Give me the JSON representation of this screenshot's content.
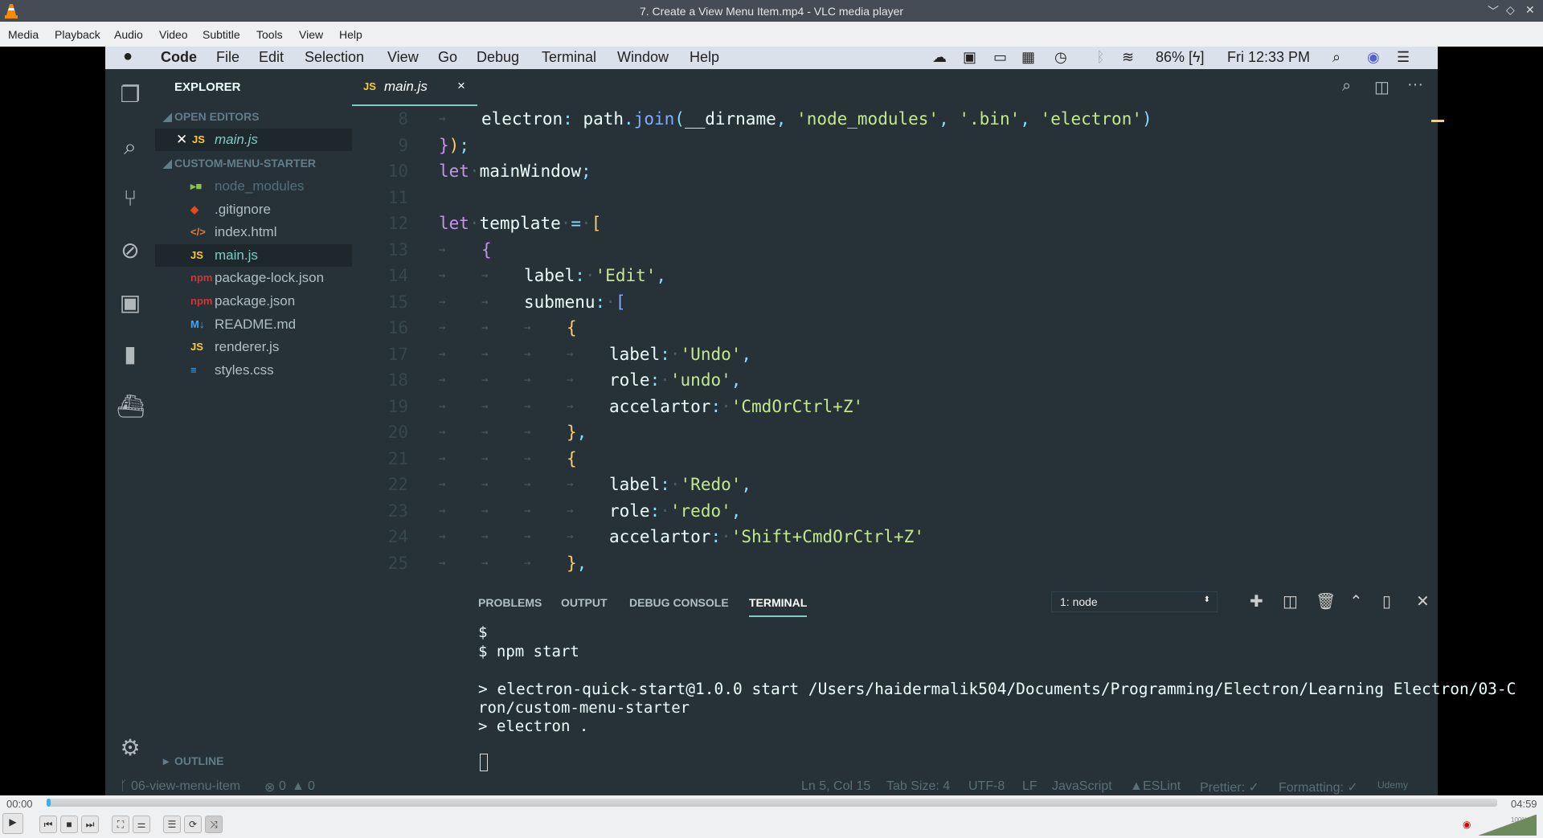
{
  "window": {
    "title": "7. Create a View Menu Item.mp4 - VLC media player"
  },
  "vlc_menu": [
    "Media",
    "Playback",
    "Audio",
    "Video",
    "Subtitle",
    "Tools",
    "View",
    "Help"
  ],
  "mac_menu": {
    "app": "Code",
    "items": [
      "File",
      "Edit",
      "Selection",
      "View",
      "Go",
      "Debug",
      "Terminal",
      "Window",
      "Help"
    ],
    "battery": "86%",
    "clock": "Fri 12:33 PM"
  },
  "sidebar": {
    "title": "EXPLORER",
    "open_editors": "OPEN EDITORS",
    "open_file": "main.js",
    "project": "CUSTOM-MENU-STARTER",
    "files": [
      {
        "name": "node_modules",
        "icon": "folder-icon",
        "badge": "▸■",
        "color": "#8bc34a"
      },
      {
        "name": ".gitignore",
        "icon": "git-icon",
        "badge": "◆",
        "color": "#e64a19"
      },
      {
        "name": "index.html",
        "icon": "html-icon",
        "badge": "</>",
        "color": "#e37933"
      },
      {
        "name": "main.js",
        "icon": "js-icon",
        "badge": "JS",
        "color": "#ffca28",
        "selected": true
      },
      {
        "name": "package-lock.json",
        "icon": "npm-icon",
        "badge": "npm",
        "color": "#cb3837"
      },
      {
        "name": "package.json",
        "icon": "npm-icon",
        "badge": "npm",
        "color": "#cb3837"
      },
      {
        "name": "README.md",
        "icon": "markdown-icon",
        "badge": "M↓",
        "color": "#42a5f5"
      },
      {
        "name": "renderer.js",
        "icon": "js-icon",
        "badge": "JS",
        "color": "#ffca28"
      },
      {
        "name": "styles.css",
        "icon": "css-icon",
        "badge": "≡",
        "color": "#42a5f5"
      }
    ],
    "outline": "OUTLINE"
  },
  "editor": {
    "tab": {
      "label": "main.js",
      "badge": "JS",
      "close": "×"
    },
    "lines": [
      {
        "n": "8",
        "indent": 1,
        "tokens": [
          [
            "electron",
            "id"
          ],
          [
            ":",
            "p"
          ],
          [
            " ",
            "ws"
          ],
          [
            "path",
            "id"
          ],
          [
            ".",
            "p"
          ],
          [
            "join",
            "fn"
          ],
          [
            "(",
            "p"
          ],
          [
            "__dirname",
            "id"
          ],
          [
            ",",
            "p"
          ],
          [
            " ",
            "ws"
          ],
          [
            "'node_modules'",
            "str"
          ],
          [
            ",",
            "p"
          ],
          [
            " ",
            "ws"
          ],
          [
            "'.bin'",
            "str"
          ],
          [
            ",",
            "p"
          ],
          [
            " ",
            "ws"
          ],
          [
            "'electron'",
            "str"
          ],
          [
            ")",
            "p"
          ]
        ]
      },
      {
        "n": "9",
        "indent": 0,
        "tokens": [
          [
            "}",
            "br1"
          ],
          [
            ")",
            "br2"
          ],
          [
            ";",
            "p"
          ]
        ]
      },
      {
        "n": "10",
        "indent": 0,
        "tokens": [
          [
            "let",
            "kw"
          ],
          [
            "·",
            "ws"
          ],
          [
            "mainWindow",
            "id"
          ],
          [
            ";",
            "p"
          ]
        ]
      },
      {
        "n": "11",
        "indent": 0,
        "tokens": []
      },
      {
        "n": "12",
        "indent": 0,
        "tokens": [
          [
            "let",
            "kw"
          ],
          [
            "·",
            "ws"
          ],
          [
            "template",
            "id"
          ],
          [
            "·",
            "ws"
          ],
          [
            "=",
            "p"
          ],
          [
            "·",
            "ws"
          ],
          [
            "[",
            "br2"
          ]
        ]
      },
      {
        "n": "13",
        "indent": 1,
        "tokens": [
          [
            "{",
            "br1"
          ]
        ]
      },
      {
        "n": "14",
        "indent": 2,
        "tokens": [
          [
            "label",
            "id"
          ],
          [
            ":",
            "p"
          ],
          [
            "·",
            "ws"
          ],
          [
            "'Edit'",
            "str"
          ],
          [
            ",",
            "p"
          ]
        ]
      },
      {
        "n": "15",
        "indent": 2,
        "tokens": [
          [
            "submenu",
            "id"
          ],
          [
            ":",
            "p"
          ],
          [
            "·",
            "ws"
          ],
          [
            "[",
            "fn"
          ]
        ]
      },
      {
        "n": "16",
        "indent": 3,
        "tokens": [
          [
            "{",
            "br2"
          ]
        ]
      },
      {
        "n": "17",
        "indent": 4,
        "tokens": [
          [
            "label",
            "id"
          ],
          [
            ":",
            "p"
          ],
          [
            "·",
            "ws"
          ],
          [
            "'Undo'",
            "str"
          ],
          [
            ",",
            "p"
          ]
        ]
      },
      {
        "n": "18",
        "indent": 4,
        "tokens": [
          [
            "role",
            "id"
          ],
          [
            ":",
            "p"
          ],
          [
            "·",
            "ws"
          ],
          [
            "'undo'",
            "str"
          ],
          [
            ",",
            "p"
          ]
        ]
      },
      {
        "n": "19",
        "indent": 4,
        "tokens": [
          [
            "accelartor",
            "id"
          ],
          [
            ":",
            "p"
          ],
          [
            "·",
            "ws"
          ],
          [
            "'CmdOrCtrl+Z'",
            "str"
          ]
        ]
      },
      {
        "n": "20",
        "indent": 3,
        "tokens": [
          [
            "}",
            "br2"
          ],
          [
            ",",
            "p"
          ]
        ]
      },
      {
        "n": "21",
        "indent": 3,
        "tokens": [
          [
            "{",
            "br2"
          ]
        ]
      },
      {
        "n": "22",
        "indent": 4,
        "tokens": [
          [
            "label",
            "id"
          ],
          [
            ":",
            "p"
          ],
          [
            "·",
            "ws"
          ],
          [
            "'Redo'",
            "str"
          ],
          [
            ",",
            "p"
          ]
        ]
      },
      {
        "n": "23",
        "indent": 4,
        "tokens": [
          [
            "role",
            "id"
          ],
          [
            ":",
            "p"
          ],
          [
            "·",
            "ws"
          ],
          [
            "'redo'",
            "str"
          ],
          [
            ",",
            "p"
          ]
        ]
      },
      {
        "n": "24",
        "indent": 4,
        "tokens": [
          [
            "accelartor",
            "id"
          ],
          [
            ":",
            "p"
          ],
          [
            "·",
            "ws"
          ],
          [
            "'Shift+CmdOrCtrl+Z'",
            "str"
          ]
        ]
      },
      {
        "n": "25",
        "indent": 3,
        "tokens": [
          [
            "}",
            "br2"
          ],
          [
            ",",
            "p"
          ]
        ]
      }
    ]
  },
  "panel": {
    "tabs": [
      "PROBLEMS",
      "OUTPUT",
      "DEBUG CONSOLE",
      "TERMINAL"
    ],
    "active_tab": "TERMINAL",
    "terminal_select": "1: node",
    "terminal_lines": [
      "$",
      "$ npm start",
      "> electron-quick-start@1.0.0 start /Users/haidermalik504/Documents/Programming/Electron/Learning Electron/03-C",
      "ron/custom-menu-starter",
      "> electron ."
    ]
  },
  "status": {
    "branch": "06-view-menu-item",
    "errors": "0",
    "warnings": "0",
    "position": "Ln 5, Col 15",
    "tab_size": "Tab Size: 4",
    "encoding": "UTF-8",
    "eol": "LF",
    "language": "JavaScript",
    "eslint": "ESLint",
    "prettier": "Prettier: ✓",
    "formatting": "Formatting: ✓",
    "watermark": "Udemy"
  },
  "player": {
    "elapsed": "00:00",
    "total": "04:59",
    "progress": 0.003,
    "volume": "100%",
    "volume_level": 1.0,
    "accent": "#3daee9"
  }
}
